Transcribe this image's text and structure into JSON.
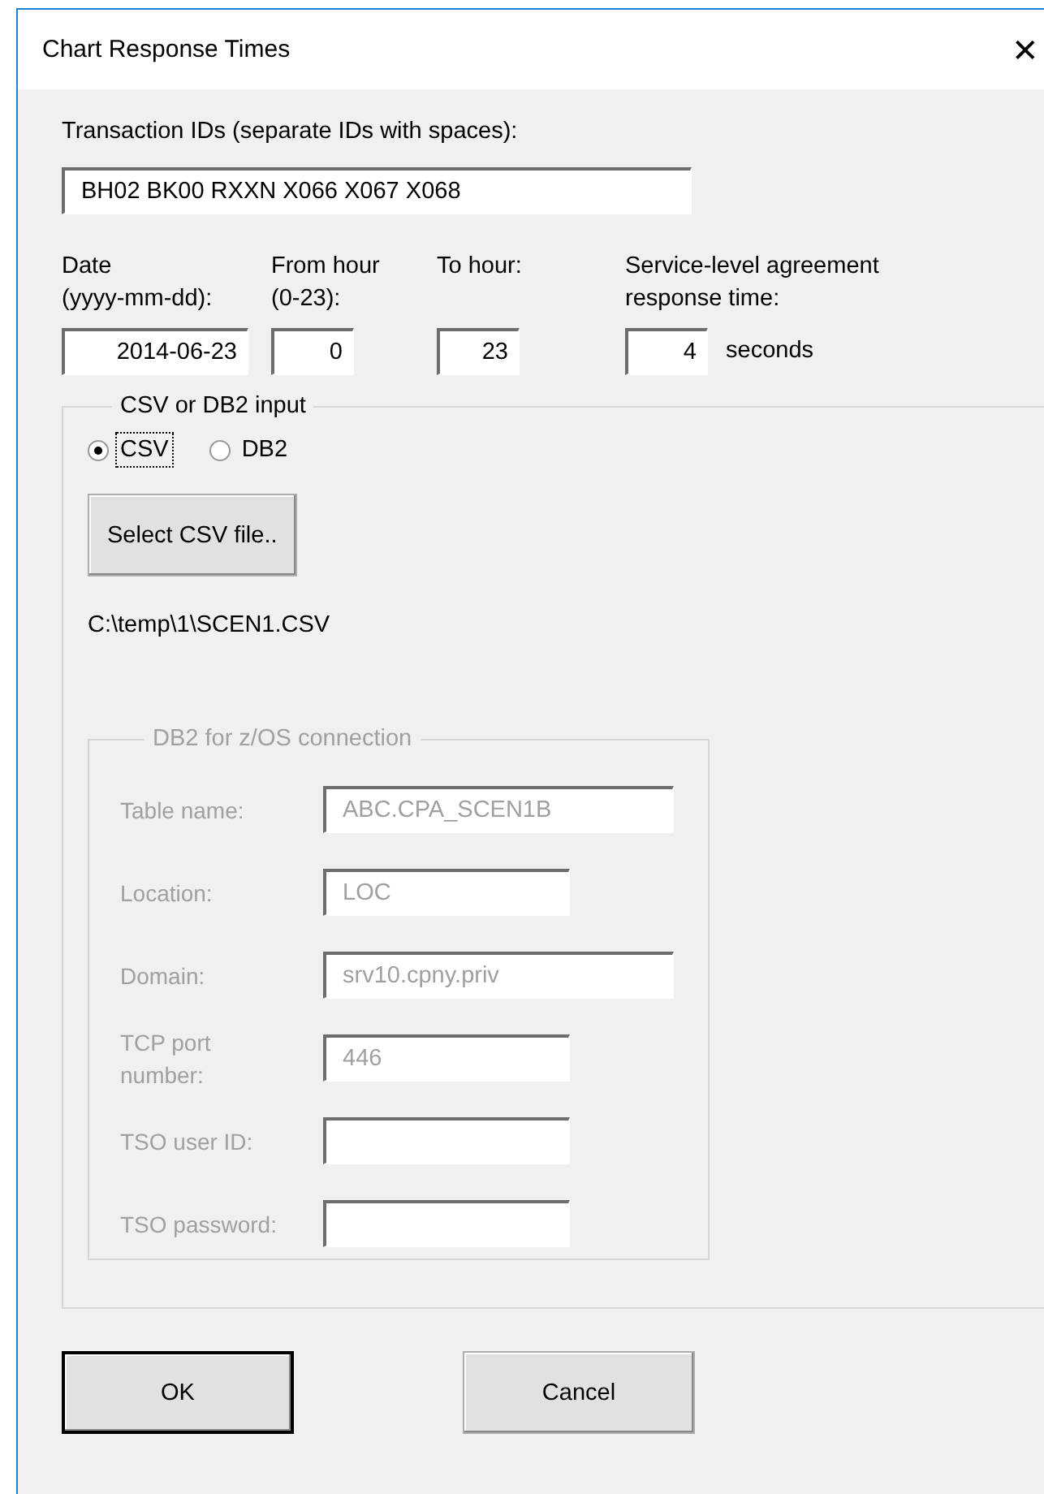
{
  "window": {
    "title": "Chart Response Times",
    "close": "✕"
  },
  "transaction_ids": {
    "label": "Transaction IDs (separate IDs with spaces):",
    "value": "BH02 BK00 RXXN X066 X067 X068"
  },
  "params": [
    {
      "label": "Date\n(yyyy-mm-dd):",
      "value": "2014-06-23"
    },
    {
      "label": "From hour\n(0-23):",
      "value": "0"
    },
    {
      "label": "To hour:",
      "value": "23"
    },
    {
      "label": "Service-level agreement\nresponse time:",
      "value": "4",
      "unit": "seconds"
    }
  ],
  "input_group": {
    "title": "CSV or DB2 input",
    "options": [
      {
        "label": "CSV",
        "selected": true,
        "focused": true
      },
      {
        "label": "DB2",
        "selected": false,
        "focused": false
      }
    ],
    "select_button": "Select CSV file..",
    "file_path": "C:\\temp\\1\\SCEN1.CSV",
    "db2_group": {
      "title": "DB2 for z/OS connection",
      "disabled": true,
      "fields": [
        {
          "label": "Table name:",
          "value": "ABC.CPA_SCEN1B"
        },
        {
          "label": "Location:",
          "value": "LOC"
        },
        {
          "label": "Domain:",
          "value": "srv10.cpny.priv"
        },
        {
          "label": "TCP port\nnumber:",
          "value": "446"
        },
        {
          "label": "TSO user ID:"
        },
        {
          "label": "TSO password:"
        }
      ]
    }
  },
  "buttons": [
    {
      "label": "OK",
      "default": true
    },
    {
      "label": "Cancel",
      "default": false
    }
  ]
}
